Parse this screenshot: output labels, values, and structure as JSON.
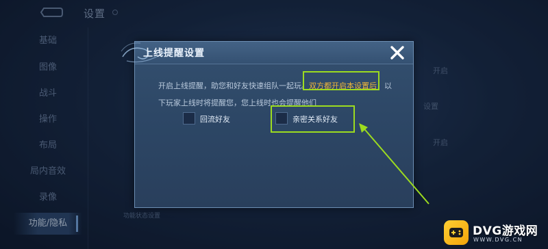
{
  "header": {
    "title": "设置"
  },
  "sidebar": {
    "items": [
      {
        "label": "基础"
      },
      {
        "label": "图像"
      },
      {
        "label": "战斗"
      },
      {
        "label": "操作"
      },
      {
        "label": "布局"
      },
      {
        "label": "局内音效"
      },
      {
        "label": "录像"
      },
      {
        "label": "功能/隐私"
      }
    ],
    "active_index": 7
  },
  "background_labels": {
    "open_1": "开启",
    "settings": "设置",
    "open_2": "开启",
    "feature_status": "功能状态设置"
  },
  "dialog": {
    "title": "上线提醒设置",
    "body_line1_prefix": "开启上线提醒，助您和好友快速组队一起玩。",
    "body_highlight": "双方都开启本设置后",
    "body_line1_suffix": "，以",
    "body_line2": "下玩家上线时将提醒您，您上线时也会提醒他们",
    "options": [
      {
        "label": "回流好友",
        "checked": false
      },
      {
        "label": "亲密关系好友",
        "checked": false
      }
    ]
  },
  "colors": {
    "highlight_text": "#f0b63a",
    "annotation": "#9ddc1f",
    "dialog_border": "#6d8fb4"
  },
  "watermark": {
    "title": "DVG游戏网",
    "url": "WWW.DVG.CN"
  }
}
